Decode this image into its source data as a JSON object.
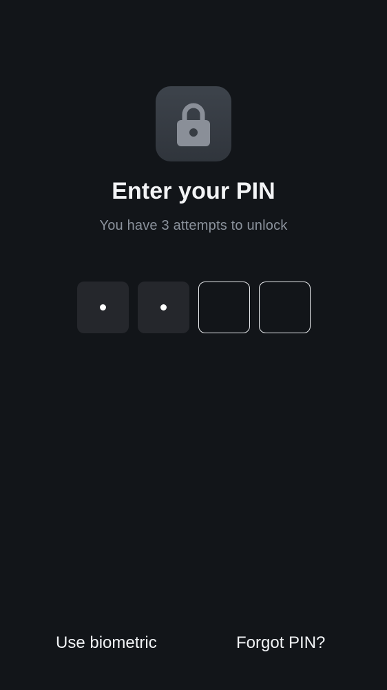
{
  "lock": {
    "icon": "lock-icon"
  },
  "title": "Enter your PIN",
  "subtitle": "You have 3 attempts to unlock",
  "pin": {
    "length": 4,
    "entered": 2
  },
  "actions": {
    "biometric_label": "Use biometric",
    "forgot_label": "Forgot PIN?"
  },
  "colors": {
    "background": "#121519",
    "tile": "#373c43",
    "filled_box": "#25272c",
    "empty_border": "#e9ebee",
    "subtitle": "#8b929c"
  }
}
